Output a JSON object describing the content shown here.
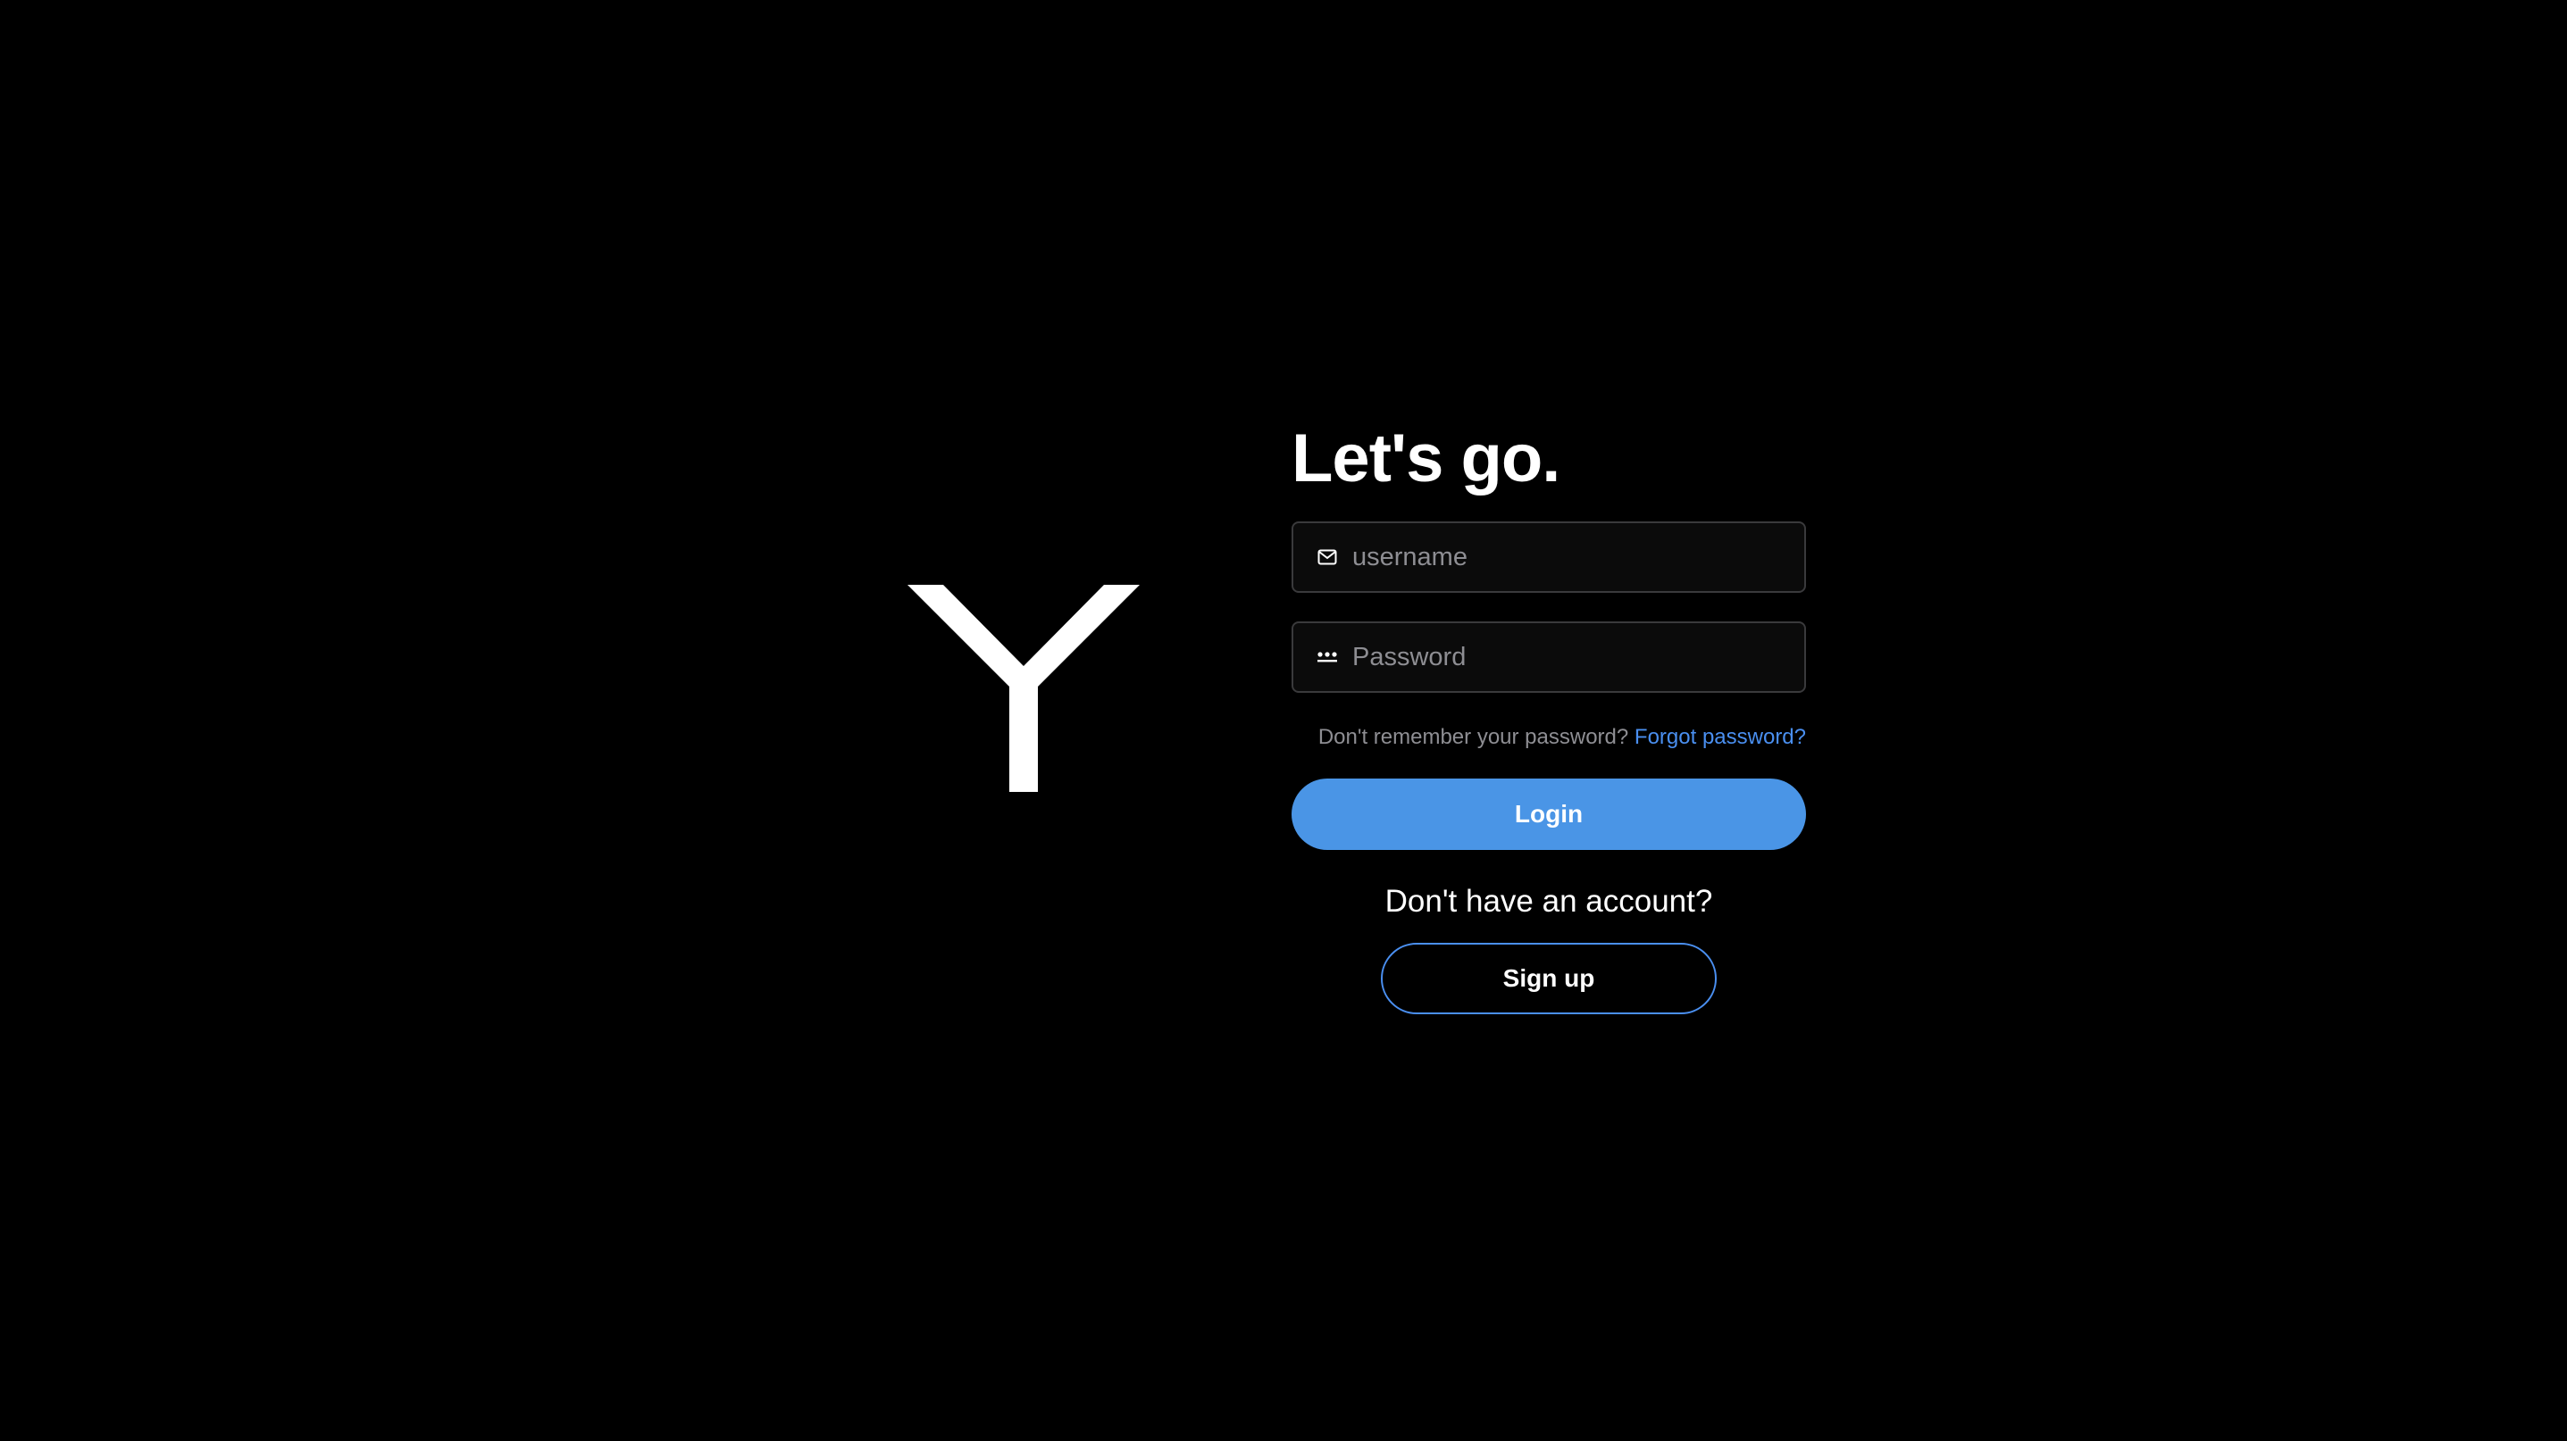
{
  "logo": {
    "icon": "y-logo-icon",
    "letter": "Y"
  },
  "form": {
    "title": "Let's go.",
    "username": {
      "placeholder": "username",
      "value": "",
      "icon": "mail-icon"
    },
    "password": {
      "placeholder": "Password",
      "value": "",
      "icon": "password-dots-icon"
    },
    "forgot_hint": "Don't remember your password?",
    "forgot_link": "Forgot password?",
    "login_label": "Login",
    "no_account_text": "Don't have an account?",
    "signup_label": "Sign up"
  },
  "colors": {
    "background": "#000000",
    "accent": "#4a95e6",
    "link": "#4a8ff0",
    "muted_text": "#8e8e93",
    "field_border": "#3a3a3c"
  }
}
